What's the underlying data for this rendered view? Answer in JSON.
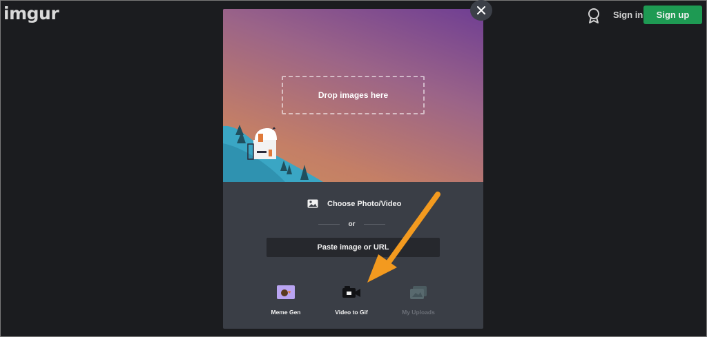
{
  "header": {
    "logo": "imgur",
    "sign_in": "Sign in",
    "sign_up": "Sign up"
  },
  "upload": {
    "drop_label": "Drop images here",
    "choose_label": "Choose Photo/Video",
    "or_label": "or",
    "paste_label": "Paste image or URL"
  },
  "tools": [
    {
      "label": "Meme Gen",
      "enabled": true
    },
    {
      "label": "Video to Gif",
      "enabled": true
    },
    {
      "label": "My Uploads",
      "enabled": false
    }
  ],
  "colors": {
    "signup_button": "#1e9a53",
    "arrow": "#f39a1f",
    "panel": "#3a3e46"
  },
  "icons": [
    "award-icon",
    "close-icon",
    "image-icon",
    "meme-icon",
    "video-camera-icon",
    "uploads-icon"
  ]
}
